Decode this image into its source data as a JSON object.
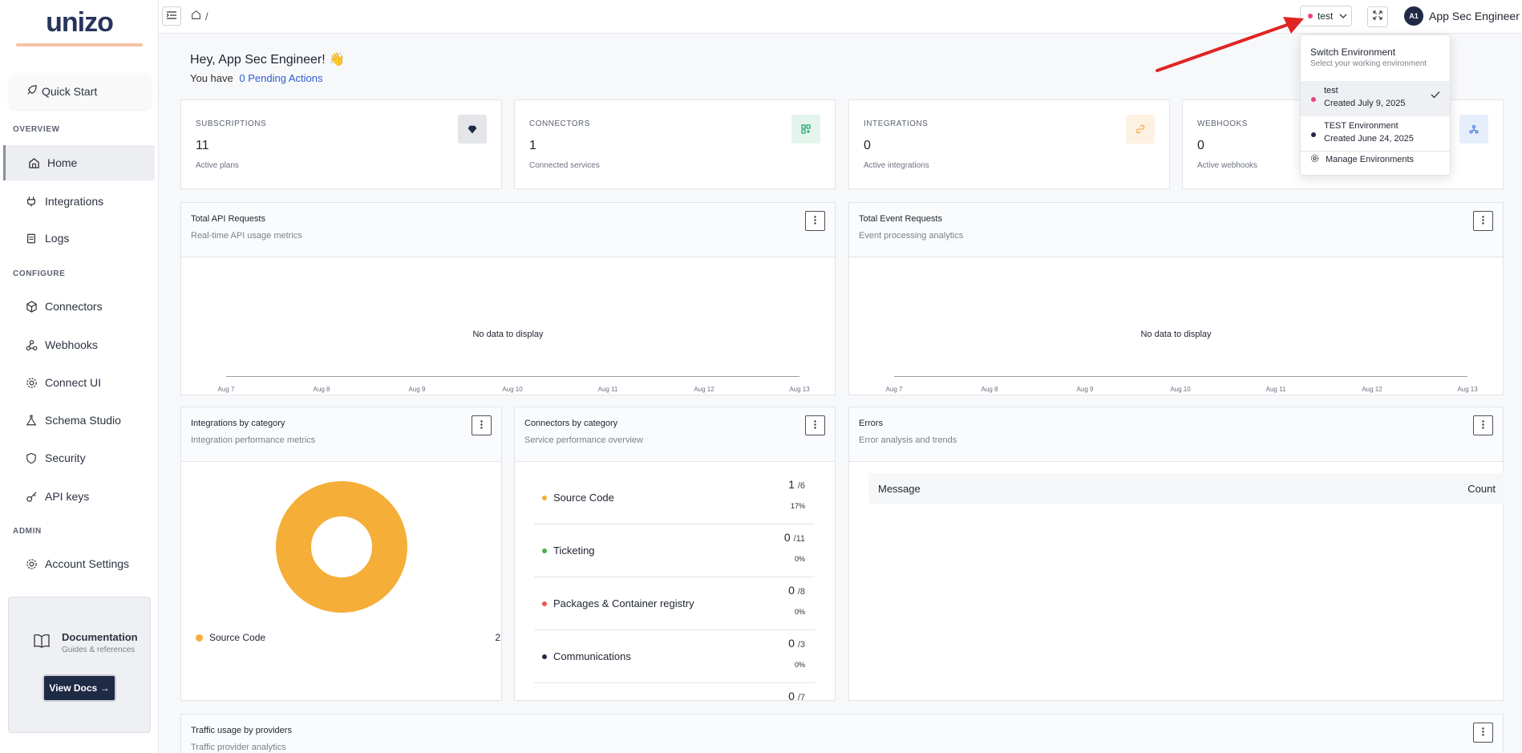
{
  "sidebar": {
    "logo": "unizo",
    "quick_start": "Quick Start",
    "sections": {
      "overview": "OVERVIEW",
      "configure": "CONFIGURE",
      "admin": "ADMIN"
    },
    "items": {
      "home": "Home",
      "integrations": "Integrations",
      "logs": "Logs",
      "connectors": "Connectors",
      "webhooks": "Webhooks",
      "connect_ui": "Connect UI",
      "schema_studio": "Schema Studio",
      "security": "Security",
      "api_keys": "API keys",
      "account_settings": "Account Settings"
    },
    "docs": {
      "title": "Documentation",
      "subtitle": "Guides & references",
      "button": "View Docs →"
    }
  },
  "topbar": {
    "breadcrumb_sep": "/",
    "env_selected": "test",
    "avatar_initials": "A1",
    "user_name": "App Sec Engineer"
  },
  "greeting": {
    "text": "Hey, App Sec Engineer! 👋",
    "pending_prefix": "You have",
    "pending_link": "0 Pending Actions"
  },
  "stats": [
    {
      "label": "SUBSCRIPTIONS",
      "value": "11",
      "sub": "Active plans"
    },
    {
      "label": "CONNECTORS",
      "value": "1",
      "sub": "Connected services"
    },
    {
      "label": "INTEGRATIONS",
      "value": "0",
      "sub": "Active integrations"
    },
    {
      "label": "WEBHOOKS",
      "value": "0",
      "sub": "Active webhooks"
    }
  ],
  "api_requests": {
    "title": "Total API Requests",
    "subtitle": "Real-time API usage metrics",
    "empty": "No data to display",
    "ticks": [
      "Aug 7",
      "Aug 8",
      "Aug 9",
      "Aug 10",
      "Aug 11",
      "Aug 12",
      "Aug 13"
    ]
  },
  "event_requests": {
    "title": "Total Event Requests",
    "subtitle": "Event processing analytics",
    "empty": "No data to display",
    "ticks": [
      "Aug 7",
      "Aug 8",
      "Aug 9",
      "Aug 10",
      "Aug 11",
      "Aug 12",
      "Aug 13"
    ]
  },
  "integrations_by_category": {
    "title": "Integrations by category",
    "subtitle": "Integration performance metrics",
    "legend": [
      {
        "name": "Source Code",
        "value": "2",
        "color": "#f5ae37"
      }
    ]
  },
  "connectors_by_category": {
    "title": "Connectors by category",
    "subtitle": "Service performance overview",
    "rows": [
      {
        "name": "Source Code",
        "count": "1",
        "total": "/6",
        "pct": "17%",
        "color": "#f5ae37"
      },
      {
        "name": "Ticketing",
        "count": "0",
        "total": "/11",
        "pct": "0%",
        "color": "#4caf50"
      },
      {
        "name": "Packages & Container registry",
        "count": "0",
        "total": "/8",
        "pct": "0%",
        "color": "#ef5350"
      },
      {
        "name": "Communications",
        "count": "0",
        "total": "/3",
        "pct": "0%",
        "color": "#1f2a44"
      },
      {
        "name": "",
        "count": "0",
        "total": "/7",
        "pct": "",
        "color": "#888888"
      }
    ]
  },
  "errors": {
    "title": "Errors",
    "subtitle": "Error analysis and trends",
    "col_message": "Message",
    "col_count": "Count"
  },
  "traffic": {
    "title": "Traffic usage by providers",
    "subtitle": "Traffic provider analytics"
  },
  "env_dropdown": {
    "title": "Switch Environment",
    "subtitle": "Select your working environment",
    "items": [
      {
        "name": "test",
        "date": "Created July 9, 2025",
        "color": "#e8457a",
        "selected": true
      },
      {
        "name": "TEST Environment",
        "date": "Created June 24, 2025",
        "color": "#1f2a44",
        "selected": false
      }
    ],
    "manage": "Manage Environments"
  },
  "colors": {
    "accent": "#2f5bd3",
    "env_dot": "#e8457a",
    "arrow": "#e02424"
  }
}
